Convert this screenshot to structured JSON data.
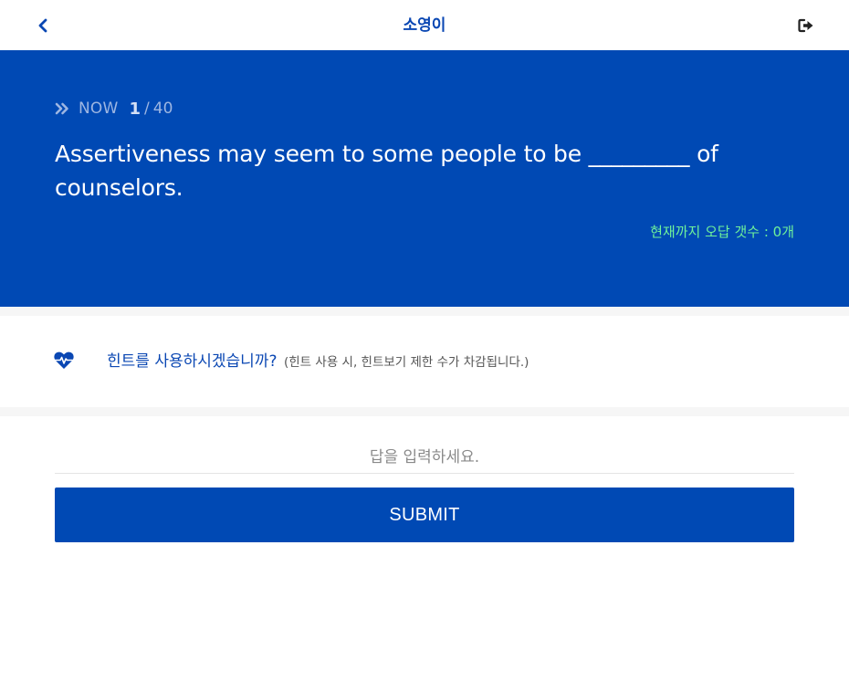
{
  "header": {
    "title": "소영이",
    "back_icon": "chevron-left-icon",
    "logout_icon": "logout-icon",
    "accent_color": "#0a47b3"
  },
  "quiz": {
    "now_label": "NOW",
    "current": "1",
    "separator": "/",
    "total": "40",
    "question": "Assertiveness may seem to some people to be _________ of counselors.",
    "wrong_count": "현재까지 오답 갯수 : 0개",
    "panel_color": "#0049b4",
    "wrong_count_color": "#6ff29a"
  },
  "hint": {
    "icon": "heartbeat-icon",
    "question": "힌트를 사용하시겠습니까?",
    "note": "(힌트 사용 시, 힌트보기 제한 수가 차감됩니다.)"
  },
  "answer": {
    "placeholder": "답을 입력하세요.",
    "value": "",
    "submit_label": "SUBMIT"
  }
}
